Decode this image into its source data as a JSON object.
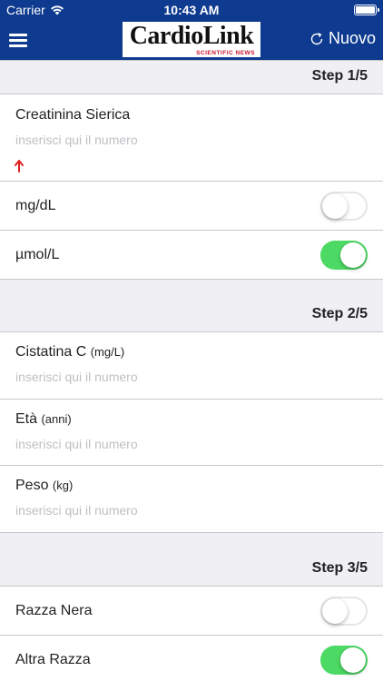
{
  "status_bar": {
    "carrier": "Carrier",
    "time": "10:43 AM",
    "icons": [
      "wifi-icon",
      "battery-icon"
    ]
  },
  "nav": {
    "menu_icon": "hamburger-menu-icon",
    "logo_text": "CardioLink",
    "logo_subtitle": "SCIENTIFIC NEWS",
    "new_button": {
      "icon": "refresh-icon",
      "label": "Nuovo"
    }
  },
  "colors": {
    "nav_background": "#0e3a8f",
    "toggle_on": "#4cd964",
    "alert_arrow": "#e02020"
  },
  "steps": [
    {
      "label": "Step 1/5",
      "fields": [
        {
          "label": "Creatinina Sierica",
          "unit": "",
          "value": "",
          "placeholder": "inserisci qui il numero",
          "indicator": "red-up-arrow-icon"
        }
      ],
      "toggles": [
        {
          "label": "mg/dL",
          "checked": false
        },
        {
          "label": "µmol/L",
          "checked": true
        }
      ]
    },
    {
      "label": "Step 2/5",
      "fields": [
        {
          "label": "Cistatina C",
          "unit": "(mg/L)",
          "value": "",
          "placeholder": "inserisci qui il numero"
        },
        {
          "label": "Età",
          "unit": "(anni)",
          "value": "",
          "placeholder": "inserisci qui il numero"
        },
        {
          "label": "Peso",
          "unit": "(kg)",
          "value": "",
          "placeholder": "inserisci qui il numero"
        }
      ]
    },
    {
      "label": "Step 3/5",
      "toggles": [
        {
          "label": "Razza Nera",
          "checked": false
        },
        {
          "label": "Altra Razza",
          "checked": true
        }
      ]
    }
  ]
}
